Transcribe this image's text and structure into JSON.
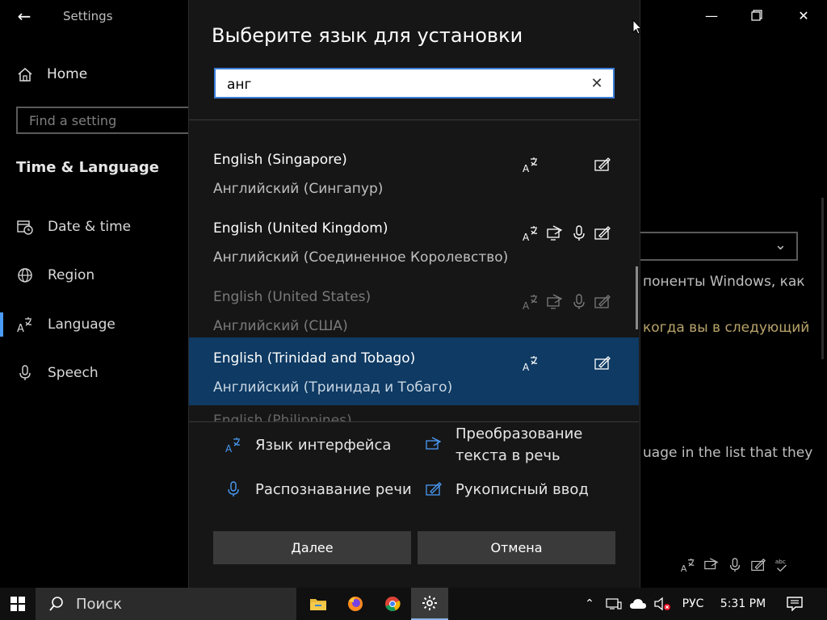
{
  "settings": {
    "title": "Settings",
    "home_label": "Home",
    "find_placeholder": "Find a setting",
    "section": "Time & Language",
    "nav": [
      {
        "label": "Date & time",
        "icon": "calendar-clock-icon"
      },
      {
        "label": "Region",
        "icon": "globe-icon"
      },
      {
        "label": "Language",
        "icon": "language-icon"
      },
      {
        "label": "Speech",
        "icon": "microphone-icon"
      }
    ],
    "bg_text_1": "поненты Windows, как",
    "bg_link": "когда вы в следующий",
    "bg_text_2": "uage in the list that they"
  },
  "dialog": {
    "title": "Выберите язык для установки",
    "search_value": "анг",
    "languages": [
      {
        "name": "English (Singapore)",
        "native": "Английский (Сингапур)",
        "features": [
          "display",
          "handwriting"
        ],
        "state": "normal"
      },
      {
        "name": "English (United Kingdom)",
        "native": "Английский (Соединенное Королевство)",
        "features": [
          "display",
          "tts",
          "speech",
          "handwriting"
        ],
        "state": "normal"
      },
      {
        "name": "English (United States)",
        "native": "Английский (США)",
        "features": [
          "display",
          "tts",
          "speech",
          "handwriting"
        ],
        "state": "dim"
      },
      {
        "name": "English (Trinidad and Tobago)",
        "native": "Английский (Тринидад и Тобаго)",
        "features": [
          "display",
          "handwriting"
        ],
        "state": "selected"
      }
    ],
    "partial_row": "English (Philippines)",
    "legend": {
      "display": "Язык интерфейса",
      "tts_line1": "Преобразование",
      "tts_line2": "текста в речь",
      "speech": "Распознавание речи",
      "handwriting": "Рукописный ввод"
    },
    "next_label": "Далее",
    "cancel_label": "Отмена"
  },
  "taskbar": {
    "search_label": "Поиск",
    "apps": [
      "file-explorer-icon",
      "firefox-icon",
      "chrome-icon",
      "settings-gear-icon"
    ],
    "lang": "РУС",
    "time": "5:31 PM"
  },
  "colors": {
    "accent": "#4a9cf7",
    "selected_row": "#0e3a63",
    "dialog_bg": "#161616"
  }
}
